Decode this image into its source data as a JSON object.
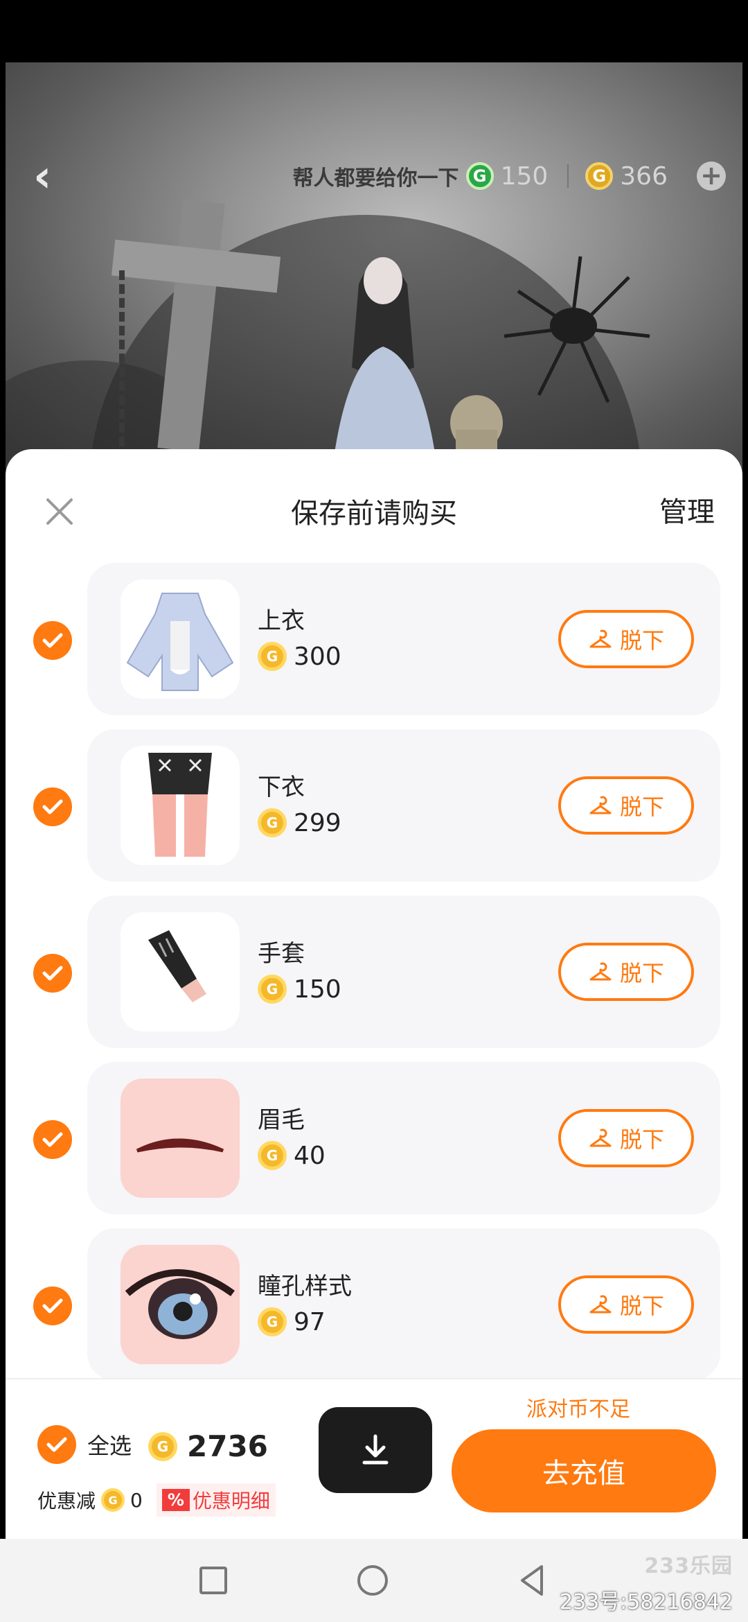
{
  "scene": {
    "hint": "帮人都要给你一下",
    "currency_green_value": "150",
    "currency_gold_value": "366"
  },
  "sheet": {
    "title": "保存前请购买",
    "manage_label": "管理"
  },
  "items": [
    {
      "name": "上衣",
      "price": "300",
      "action": "脱下",
      "checked": true
    },
    {
      "name": "下衣",
      "price": "299",
      "action": "脱下",
      "checked": true
    },
    {
      "name": "手套",
      "price": "150",
      "action": "脱下",
      "checked": true
    },
    {
      "name": "眉毛",
      "price": "40",
      "action": "脱下",
      "checked": true
    },
    {
      "name": "瞳孔样式",
      "price": "97",
      "action": "脱下",
      "checked": true
    }
  ],
  "footer": {
    "insufficient_text": "派对币不足",
    "select_all_label": "全选",
    "total": "2736",
    "discount_label": "优惠减",
    "discount_value": "0",
    "discount_tag": "%",
    "discount_detail_label": "优惠明细",
    "recharge_label": "去充值"
  },
  "watermark": {
    "logo": "233乐园",
    "id_text": "233号:58216842"
  },
  "colors": {
    "accent": "#ff7a10",
    "card_bg": "#f6f5f8",
    "coin": "#f5b82a",
    "discount_red": "#f23c3c"
  }
}
